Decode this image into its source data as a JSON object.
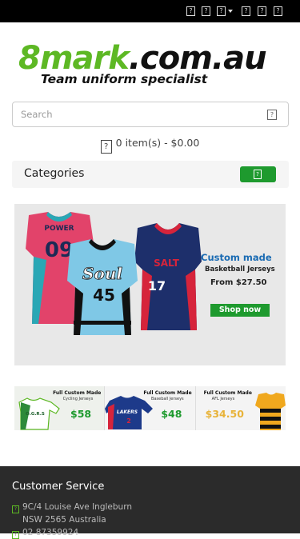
{
  "topbar": {
    "icons": [
      "phone-icon",
      "user-icon",
      "account-icon",
      "heart-icon",
      "cart-icon",
      "checkout-icon"
    ],
    "glyph": "?"
  },
  "logo": {
    "domain_green": "8mark",
    "domain_dark": ".com.au",
    "tagline": "Team uniform specialist",
    "brand_green": "#5db824"
  },
  "search": {
    "placeholder": "Search",
    "value": "",
    "button_glyph": "?"
  },
  "cart": {
    "summary": "0 item(s) - $0.00",
    "icon_glyph": "?"
  },
  "categories": {
    "label": "Categories",
    "button_glyph": "?",
    "accent": "#1e9a2e"
  },
  "banner": {
    "title": "Custom made",
    "subtitle": "Basketball Jerseys",
    "price": "From $27.50",
    "cta": "Shop now",
    "jersey_numbers": [
      "09",
      "45",
      "17"
    ],
    "jersey_words": [
      "POWER",
      "Soul",
      "SALT"
    ]
  },
  "promos": [
    {
      "title": "Full Custom Made",
      "subtitle": "Cycling Jerseys",
      "price": "$58"
    },
    {
      "title": "Full Custom Made",
      "subtitle": "Baseball Jerseys",
      "price": "$48"
    },
    {
      "title": "Full Custom Made",
      "subtitle": "AFL Jerseys",
      "price": "$34.50"
    }
  ],
  "promo_graphics": {
    "cycling_text": "O.G.R.S",
    "baseball_text": "LAKERS",
    "baseball_number": "2"
  },
  "footer": {
    "title": "Customer Service",
    "address_line1": "9C/4 Louise Ave Ingleburn",
    "address_line2": "NSW 2565 Australia",
    "phone": "02 87359924",
    "icon_glyph": "?"
  }
}
